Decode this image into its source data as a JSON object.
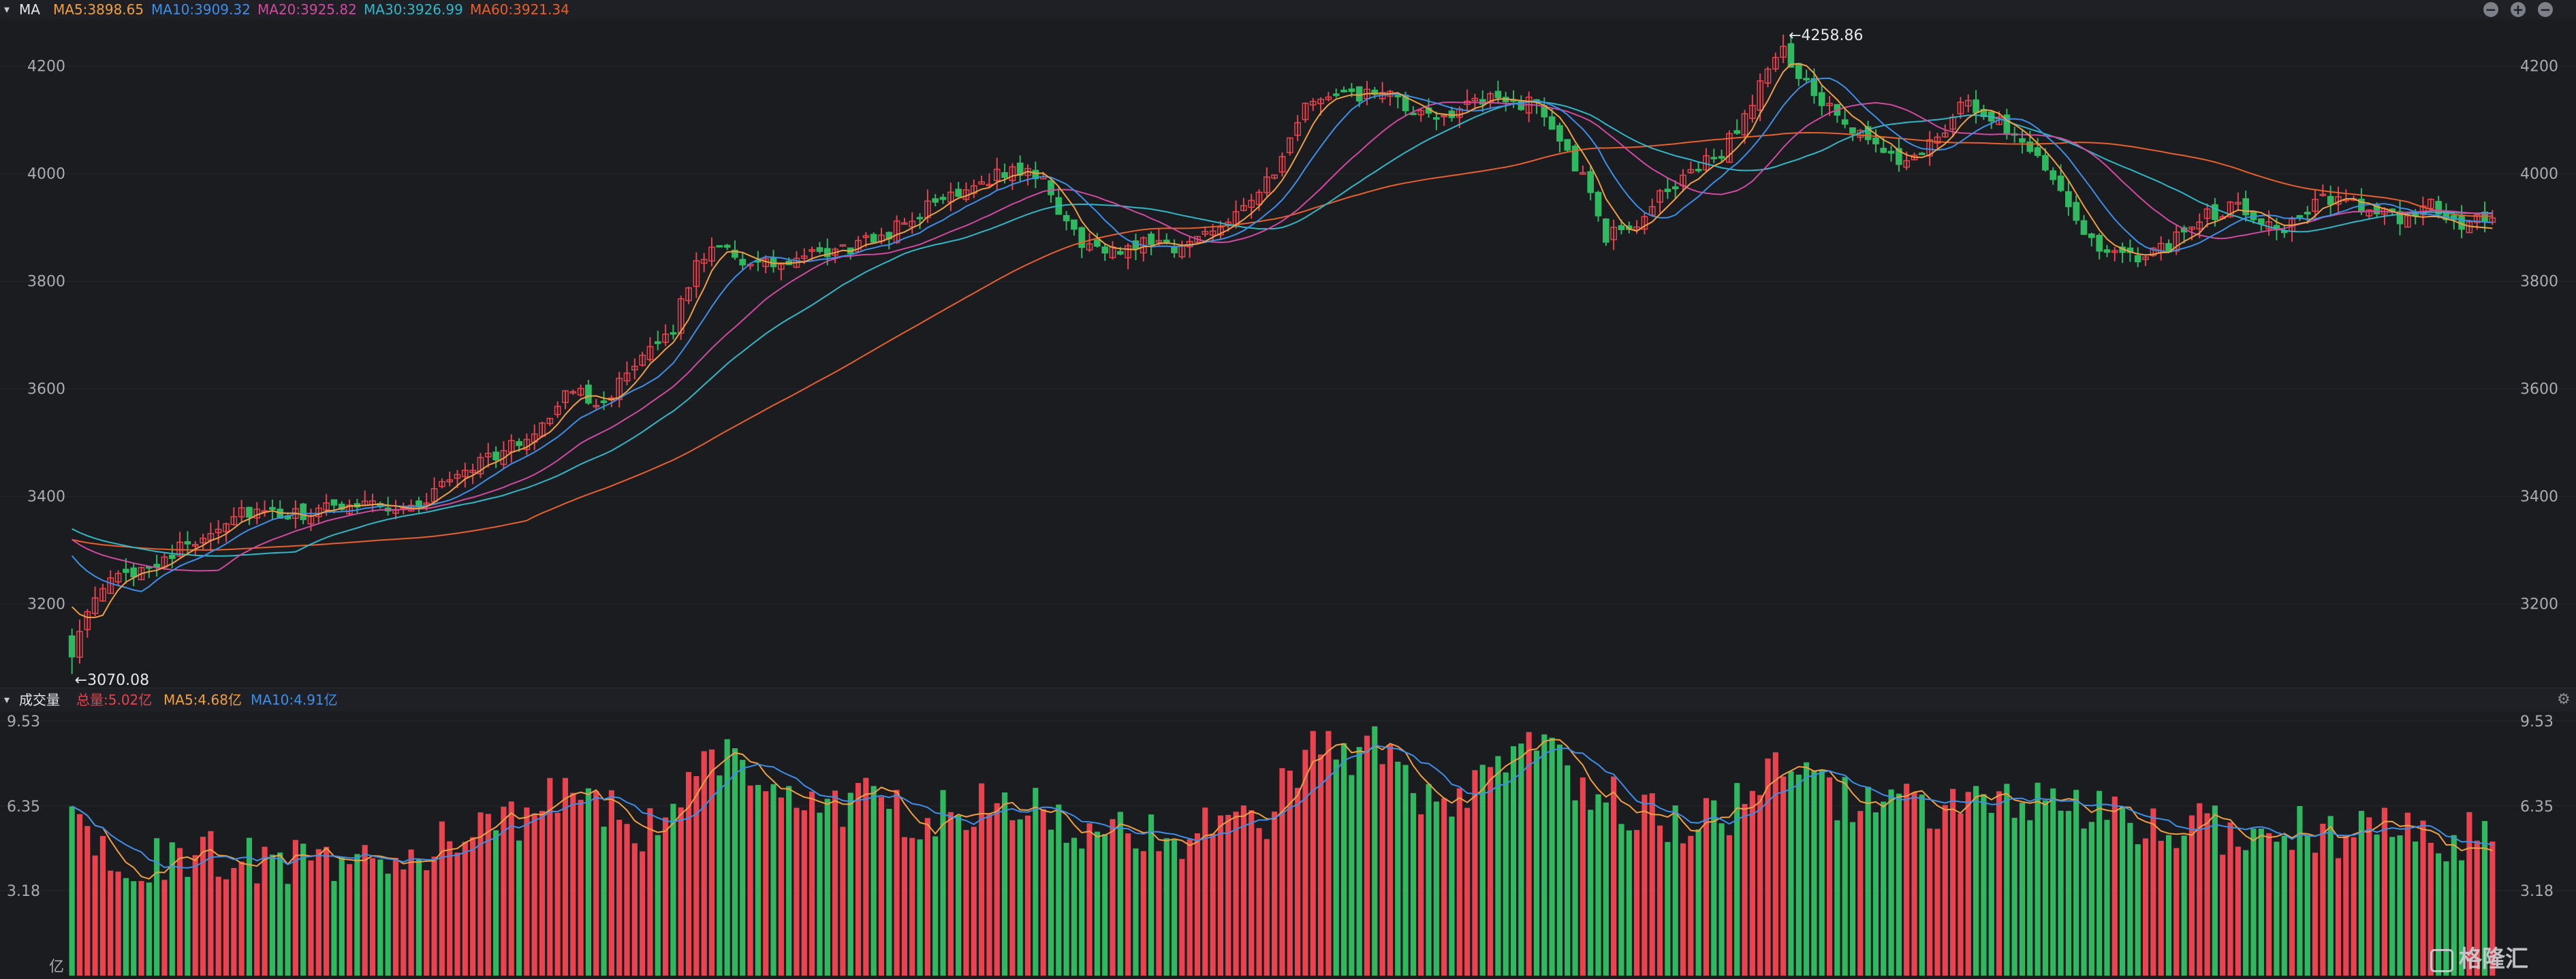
{
  "header": {
    "indicator": "MA",
    "ma5": "MA5:3898.65",
    "ma10": "MA10:3909.32",
    "ma20": "MA20:3925.82",
    "ma30": "MA30:3926.99",
    "ma60": "MA60:3921.34"
  },
  "volume_header": {
    "title": "成交量",
    "total": "总量:5.02亿",
    "ma5": "MA5:4.68亿",
    "ma10": "MA10:4.91亿"
  },
  "colors": {
    "up": "#e8434e",
    "down": "#2fb860",
    "ma5": "#f0a040",
    "ma10": "#3d8fe8",
    "ma20": "#d04aa0",
    "ma30": "#2fb8c8",
    "ma60": "#e8602a",
    "grid": "#26272d",
    "axis_text": "#a9abb3"
  },
  "watermark": "格隆汇",
  "chart_data": [
    {
      "type": "candlestick",
      "panel": "price",
      "y_ticks": [
        3200,
        3400,
        3600,
        3800,
        4000,
        4200
      ],
      "ylim": [
        3060,
        4275
      ],
      "grid": true,
      "max_label": "4258.86",
      "min_label": "3070.08",
      "max_value": 4258.86,
      "min_value": 3070.08,
      "candle_count": 315,
      "close_anchors": [
        [
          0,
          3115
        ],
        [
          6,
          3235
        ],
        [
          20,
          3300
        ],
        [
          25,
          3330
        ],
        [
          32,
          3375
        ],
        [
          40,
          3360
        ],
        [
          48,
          3375
        ],
        [
          55,
          3395
        ],
        [
          62,
          3375
        ],
        [
          66,
          3385
        ],
        [
          72,
          3440
        ],
        [
          78,
          3470
        ],
        [
          85,
          3500
        ],
        [
          95,
          3600
        ],
        [
          100,
          3575
        ],
        [
          108,
          3650
        ],
        [
          114,
          3720
        ],
        [
          118,
          3830
        ],
        [
          122,
          3880
        ],
        [
          128,
          3830
        ],
        [
          134,
          3830
        ],
        [
          142,
          3850
        ],
        [
          150,
          3870
        ],
        [
          156,
          3900
        ],
        [
          164,
          3950
        ],
        [
          172,
          3990
        ],
        [
          180,
          4010
        ],
        [
          184,
          3980
        ],
        [
          190,
          3880
        ],
        [
          196,
          3850
        ],
        [
          204,
          3880
        ],
        [
          210,
          3860
        ],
        [
          220,
          3930
        ],
        [
          228,
          4000
        ],
        [
          234,
          4140
        ],
        [
          240,
          4140
        ],
        [
          248,
          4150
        ],
        [
          256,
          4100
        ],
        [
          262,
          4120
        ],
        [
          270,
          4140
        ],
        [
          278,
          4125
        ],
        [
          286,
          3990
        ],
        [
          290,
          3880
        ],
        [
          296,
          3910
        ],
        [
          304,
          3990
        ],
        [
          312,
          4040
        ],
        [
          318,
          4130
        ],
        [
          323,
          4240
        ],
        [
          330,
          4140
        ],
        [
          338,
          4070
        ],
        [
          346,
          4020
        ],
        [
          352,
          4060
        ],
        [
          358,
          4130
        ],
        [
          364,
          4100
        ],
        [
          370,
          4060
        ],
        [
          376,
          3980
        ],
        [
          382,
          3870
        ],
        [
          388,
          3840
        ],
        [
          396,
          3860
        ],
        [
          402,
          3920
        ],
        [
          410,
          3940
        ],
        [
          418,
          3900
        ],
        [
          426,
          3950
        ],
        [
          434,
          3940
        ],
        [
          440,
          3910
        ],
        [
          446,
          3950
        ],
        [
          452,
          3900
        ],
        [
          458,
          3920
        ]
      ],
      "ma_start_values": {
        "ma5": 3195,
        "ma10": 3290,
        "ma20": 3320,
        "ma30": 3340,
        "ma60": 3320
      },
      "ma_end_values": {
        "ma5": 3898.65,
        "ma10": 3909.32,
        "ma20": 3925.82,
        "ma30": 3926.99,
        "ma60": 3921.34
      }
    },
    {
      "type": "bar",
      "panel": "volume",
      "unit": "亿",
      "y_ticks": [
        3.18,
        6.35,
        9.53
      ],
      "ylim": [
        0,
        9.53
      ],
      "volume_anchors": [
        [
          0,
          5.4
        ],
        [
          5,
          4.3
        ],
        [
          10,
          4.0
        ],
        [
          20,
          4.2
        ],
        [
          30,
          4.4
        ],
        [
          40,
          4.2
        ],
        [
          50,
          4.1
        ],
        [
          60,
          4.3
        ],
        [
          70,
          4.8
        ],
        [
          80,
          5.1
        ],
        [
          88,
          6.1
        ],
        [
          95,
          7.5
        ],
        [
          100,
          6.5
        ],
        [
          106,
          5.2
        ],
        [
          112,
          5.9
        ],
        [
          118,
          7.2
        ],
        [
          124,
          8.3
        ],
        [
          128,
          7.8
        ],
        [
          134,
          6.4
        ],
        [
          140,
          6.2
        ],
        [
          150,
          6.6
        ],
        [
          156,
          6.1
        ],
        [
          162,
          5.8
        ],
        [
          170,
          6.2
        ],
        [
          180,
          6.1
        ],
        [
          190,
          5.6
        ],
        [
          196,
          5.1
        ],
        [
          205,
          5.3
        ],
        [
          215,
          5.2
        ],
        [
          225,
          5.7
        ],
        [
          232,
          7.4
        ],
        [
          236,
          8.6
        ],
        [
          240,
          8.0
        ],
        [
          246,
          8.4
        ],
        [
          252,
          7.4
        ],
        [
          256,
          6.2
        ],
        [
          262,
          5.8
        ],
        [
          268,
          7.6
        ],
        [
          272,
          8.3
        ],
        [
          278,
          8.1
        ],
        [
          282,
          7.6
        ],
        [
          288,
          6.9
        ],
        [
          294,
          6.3
        ],
        [
          300,
          5.9
        ],
        [
          306,
          5.5
        ],
        [
          312,
          5.9
        ],
        [
          318,
          6.7
        ],
        [
          323,
          7.5
        ],
        [
          330,
          6.9
        ],
        [
          336,
          6.5
        ],
        [
          342,
          6.3
        ],
        [
          350,
          6.1
        ],
        [
          358,
          6.4
        ],
        [
          364,
          6.5
        ],
        [
          370,
          6.2
        ],
        [
          376,
          6.3
        ],
        [
          382,
          5.9
        ],
        [
          388,
          5.6
        ],
        [
          396,
          5.4
        ],
        [
          404,
          5.5
        ],
        [
          412,
          5.2
        ],
        [
          418,
          5.3
        ],
        [
          426,
          5.4
        ],
        [
          434,
          5.1
        ],
        [
          442,
          5.3
        ],
        [
          450,
          5.1
        ],
        [
          458,
          5.0
        ]
      ],
      "total_value": 5.02,
      "ma5_value": 4.68,
      "ma10_value": 4.91
    }
  ]
}
